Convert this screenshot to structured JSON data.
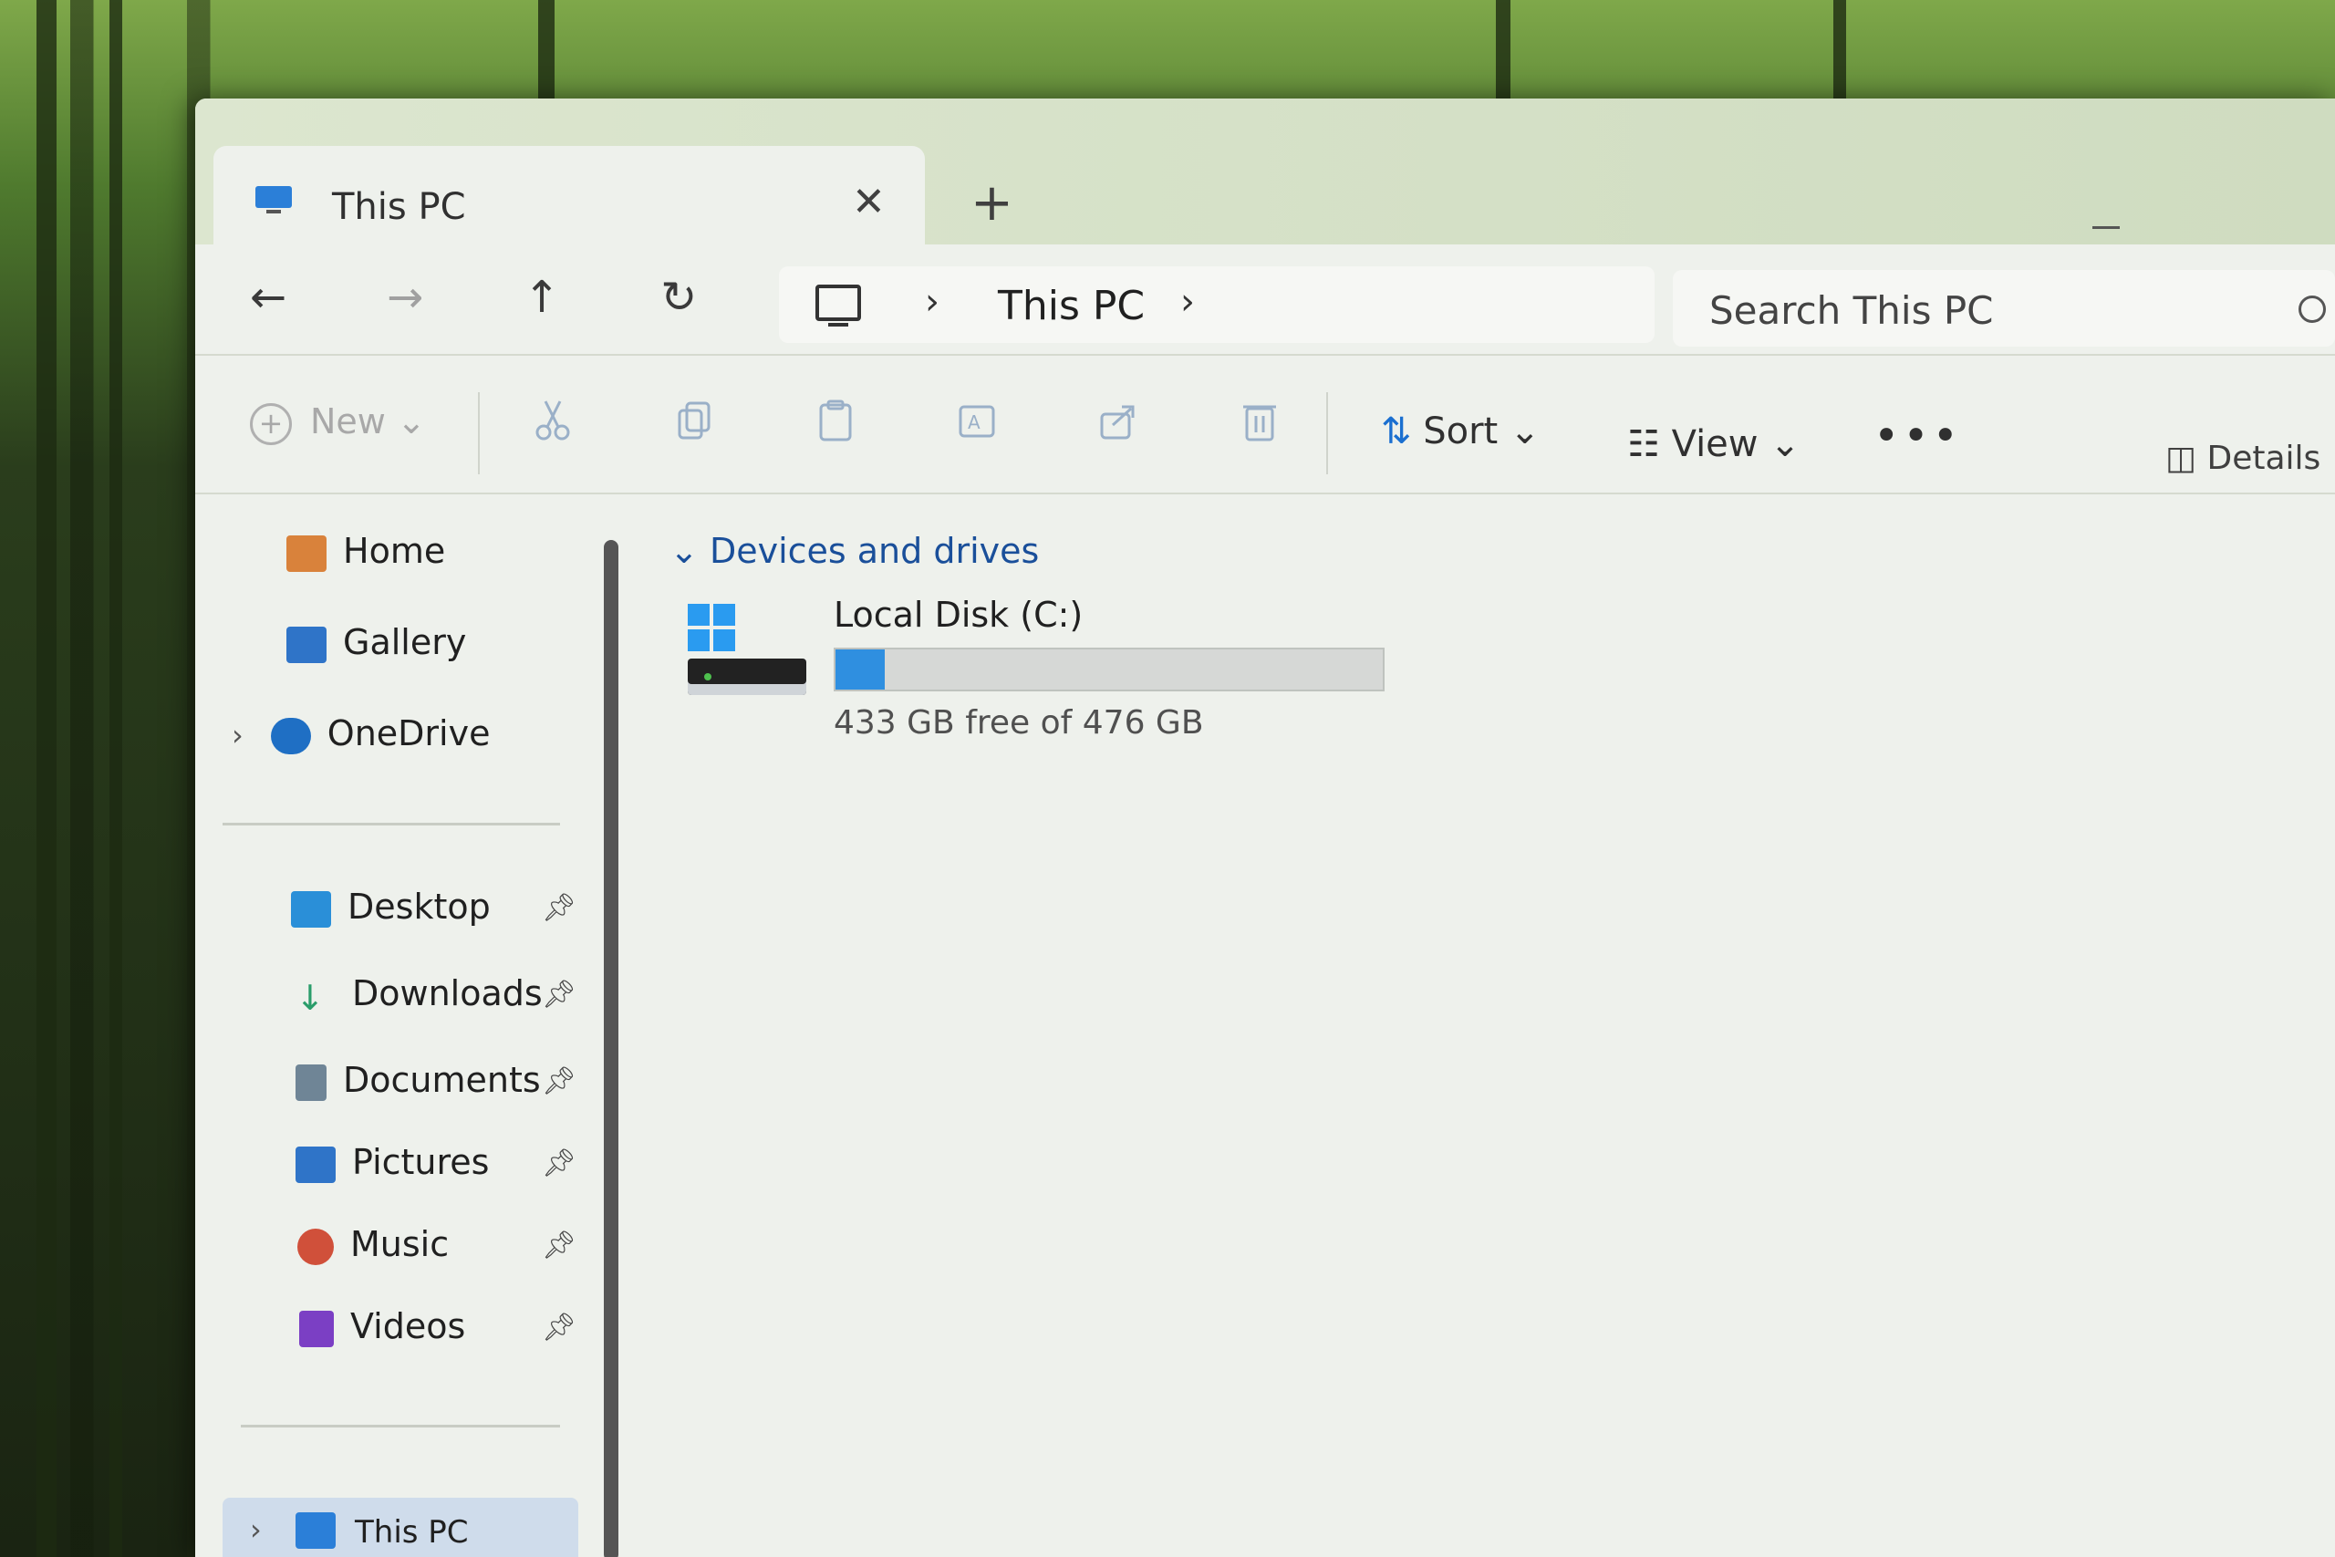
{
  "window": {
    "tab_title": "This PC",
    "tab_close": "✕",
    "new_tab": "+"
  },
  "nav": {
    "back": "←",
    "forward": "→",
    "up": "↑",
    "refresh": "↻",
    "separator": "›",
    "breadcrumb": [
      "This PC"
    ]
  },
  "search": {
    "placeholder": "Search This PC"
  },
  "toolbar": {
    "new_label": "New",
    "sort_label": "Sort",
    "view_label": "View",
    "more_label": "•••",
    "details_label": "Details",
    "chevron": "⌄",
    "icons": [
      "scissors-icon",
      "copy-icon",
      "paste-icon",
      "rename-icon",
      "share-icon",
      "trash-icon"
    ]
  },
  "sidebar": {
    "items": [
      {
        "label": "Home",
        "icon": "home-icon"
      },
      {
        "label": "Gallery",
        "icon": "gallery-icon"
      },
      {
        "label": "OneDrive",
        "icon": "onedrive-icon",
        "expandable": true
      }
    ],
    "quick_access": [
      {
        "label": "Desktop",
        "icon": "desktop-icon",
        "pinned": true
      },
      {
        "label": "Downloads",
        "icon": "downloads-icon",
        "pinned": true
      },
      {
        "label": "Documents",
        "icon": "documents-icon",
        "pinned": true
      },
      {
        "label": "Pictures",
        "icon": "pictures-icon",
        "pinned": true
      },
      {
        "label": "Music",
        "icon": "music-icon",
        "pinned": true
      },
      {
        "label": "Videos",
        "icon": "videos-icon",
        "pinned": true
      }
    ],
    "this_pc": "This PC"
  },
  "main": {
    "group_header": "Devices and drives",
    "drives": [
      {
        "name": "Local Disk (C:)",
        "free_text": "433 GB free of 476 GB",
        "used_fraction": 0.09
      }
    ]
  },
  "colors": {
    "accent": "#1a6fd0",
    "drive_bar": "#2f8fe0",
    "group_header": "#1a4f9a"
  }
}
